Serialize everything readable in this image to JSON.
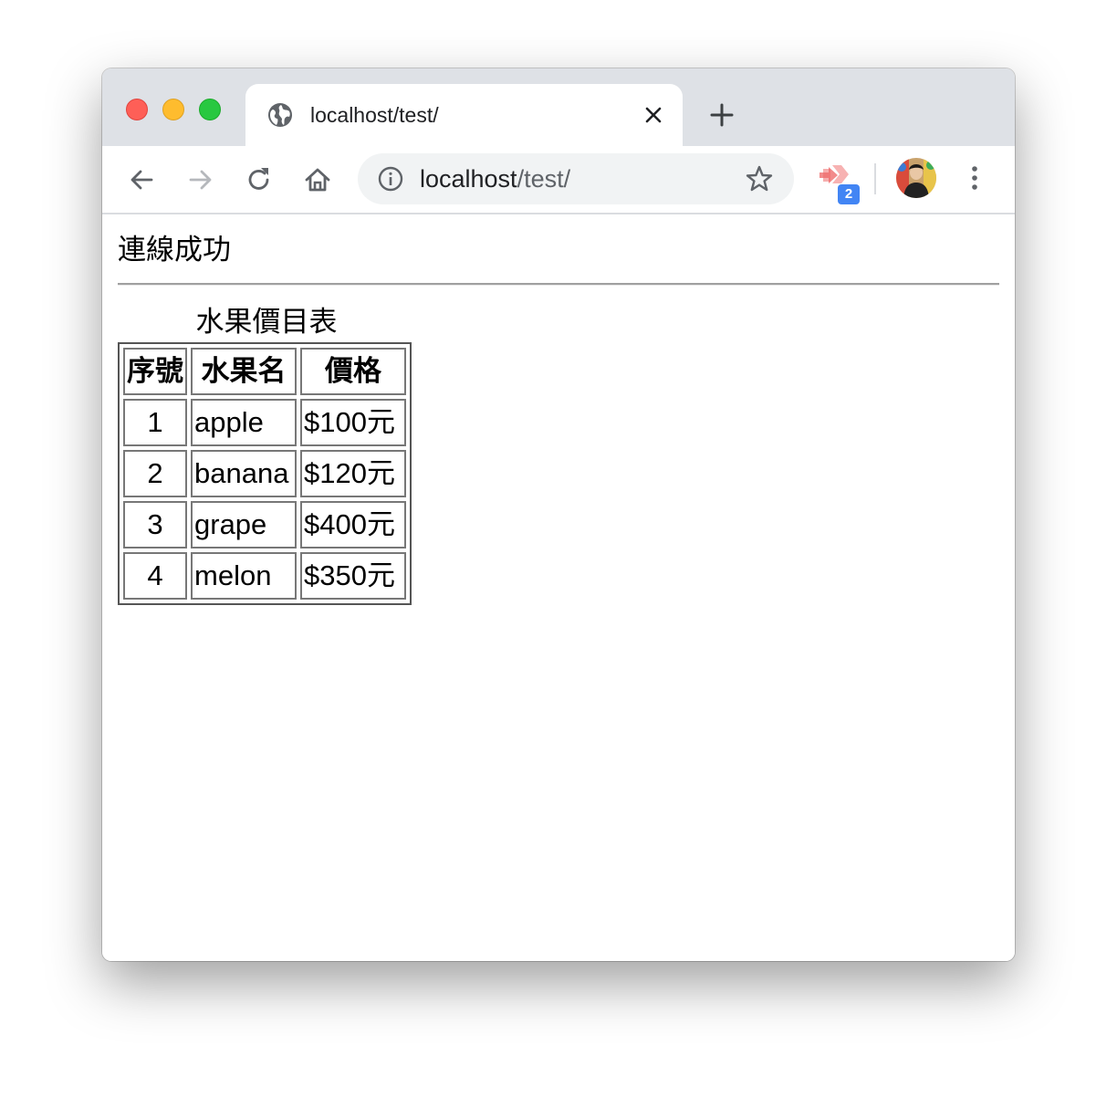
{
  "browser": {
    "tab": {
      "title": "localhost/test/",
      "favicon": "globe-icon"
    },
    "omnibox": {
      "host": "localhost",
      "path": "/test/"
    },
    "extension_badge": "2",
    "colors": {
      "tabstrip": "#dee1e6",
      "omnibox": "#f1f3f4",
      "badge": "#4285f4",
      "close_dot": "#fe5f57",
      "minimize_dot": "#febc2e",
      "maximize_dot": "#28c840"
    }
  },
  "page": {
    "status_text": "連線成功",
    "table": {
      "caption": "水果價目表",
      "headers": [
        "序號",
        "水果名",
        "價格"
      ],
      "rows": [
        [
          "1",
          "apple",
          "$100元"
        ],
        [
          "2",
          "banana",
          "$120元"
        ],
        [
          "3",
          "grape",
          "$400元"
        ],
        [
          "4",
          "melon",
          "$350元"
        ]
      ]
    }
  }
}
